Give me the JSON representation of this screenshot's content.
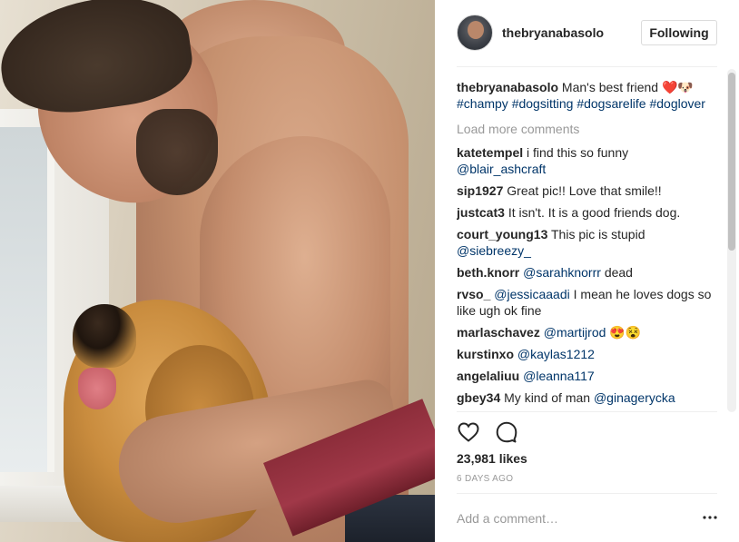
{
  "post": {
    "username": "thebryanabasolo",
    "follow_label": "Following",
    "caption": {
      "username": "thebryanabasolo",
      "text": "Man's best friend ❤️🐶",
      "hashtags": [
        "#champy",
        "#dogsitting",
        "#dogsarelife",
        "#doglover"
      ]
    },
    "load_more_label": "Load more comments",
    "comments": [
      {
        "user": "katetempel",
        "text": "i find this so funny",
        "tag": "@blair_ashcraft"
      },
      {
        "user": "sip1927",
        "text": "Great pic!! Love that smile!!",
        "tag": ""
      },
      {
        "user": "justcat3",
        "text": "It isn't. It is a good friends dog.",
        "tag": ""
      },
      {
        "user": "court_young13",
        "text": "This pic is stupid",
        "tag": "@siebreezy_"
      },
      {
        "user": "beth.knorr",
        "tag_before": "@sarahknorrr",
        "text": "dead"
      },
      {
        "user": "rvso_",
        "tag_before": "@jessicaaadi",
        "text": "I mean he loves dogs so like ugh ok fine"
      },
      {
        "user": "marlaschavez",
        "tag_before": "@martijrod",
        "text": "😍😵"
      },
      {
        "user": "kurstinxo",
        "tag_before": "@kaylas1212",
        "text": ""
      },
      {
        "user": "angelaliuu",
        "tag_before": "@leanna117",
        "text": ""
      },
      {
        "user": "gbey34",
        "text": "My kind of man",
        "tag": "@ginagerycka"
      }
    ],
    "likes_label": "23,981 likes",
    "age_label": "6 DAYS AGO",
    "comment_placeholder": "Add a comment…"
  },
  "icons": {
    "like": "heart-outline-icon",
    "comment": "speech-bubble-icon",
    "more": "ellipsis-icon"
  },
  "colors": {
    "link": "#003569",
    "muted": "#999999",
    "text": "#262626"
  }
}
